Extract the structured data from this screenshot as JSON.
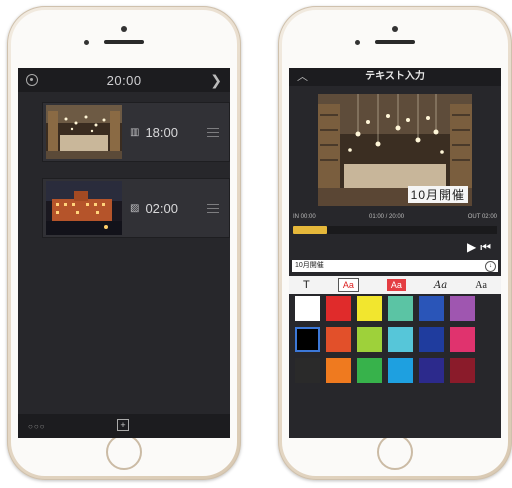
{
  "left_phone": {
    "header": {
      "time": "20:00",
      "settings_icon": "gear-icon",
      "next_icon": "chevron-right-icon"
    },
    "clips": [
      {
        "type_icon": "video-clip-icon",
        "duration": "18:00"
      },
      {
        "type_icon": "photo-clip-icon",
        "duration": "02:00"
      }
    ],
    "footer": {
      "more_icon": "ellipsis-icon",
      "add_icon": "add-clip-icon"
    }
  },
  "right_phone": {
    "header": {
      "title": "テキスト入力",
      "collapse_icon": "chevron-up-icon"
    },
    "preview_caption": "10月開催",
    "timeline": {
      "in_label": "IN 00:00",
      "position": "01:00 / 20:00",
      "out_label": "OUT 02:00"
    },
    "controls": {
      "play_icon": "play-icon",
      "skip_icon": "skip-to-start-icon"
    },
    "text_input": {
      "value": "10月開催",
      "dropdown_icon": "download-circle-icon"
    },
    "font_styles": [
      "T",
      "Aa",
      "Aa",
      "Aa",
      "Aa"
    ],
    "colors": [
      [
        "#ffffff",
        "#e02b2b",
        "#f2e62e",
        "#5bc4a4",
        "#2a55b8",
        "#9f56b0"
      ],
      [
        "#000000",
        "#e2502a",
        "#9ed13a",
        "#56c6d9",
        "#1f3c9e",
        "#e0336e"
      ],
      [
        "#2a2a2a",
        "#ef7a1f",
        "#37b24b",
        "#1ea0e0",
        "#2c2a8c",
        "#8a1b2a"
      ]
    ],
    "selected_color": "#000000"
  }
}
